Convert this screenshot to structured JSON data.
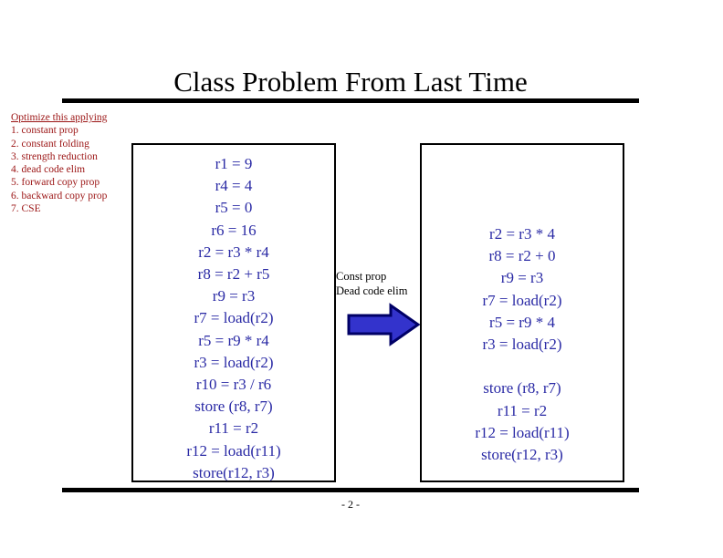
{
  "slide": {
    "title": "Class Problem From Last Time",
    "page_number": "- 2 -",
    "text_color": "#000000",
    "code_color": "#2a2aa5",
    "list_color": "#9b1414"
  },
  "optimize_list": {
    "heading": "Optimize this applying",
    "items": [
      "1. constant prop",
      "2. constant folding",
      "3. strength reduction",
      "4. dead code elim",
      "5. forward copy prop",
      "6. backward copy prop",
      "7. CSE"
    ]
  },
  "before_box": {
    "lines": [
      "r1 = 9",
      "r4 = 4",
      "r5 = 0",
      "r6 = 16",
      "r2 = r3 * r4",
      "r8 = r2 + r5",
      "r9 = r3",
      "r7 = load(r2)",
      "r5 = r9 * r4",
      "r3 = load(r2)",
      "r10 = r3 / r6",
      "store (r8, r7)",
      "r11 = r2",
      "r12 = load(r11)",
      "store(r12, r3)"
    ]
  },
  "transform": {
    "label_line1": "Const prop",
    "label_line2": "Dead code elim",
    "arrow_fill": "#3333cc",
    "arrow_stroke": "#000066"
  },
  "after_box": {
    "lines": [
      "r2 = r3 * 4",
      "r8 = r2 + 0",
      "r9 = r3",
      "r7 = load(r2)",
      "r5 = r9 * 4",
      "r3 = load(r2)",
      "",
      "store (r8, r7)",
      "r11 = r2",
      "r12 = load(r11)",
      "store(r12, r3)"
    ]
  }
}
